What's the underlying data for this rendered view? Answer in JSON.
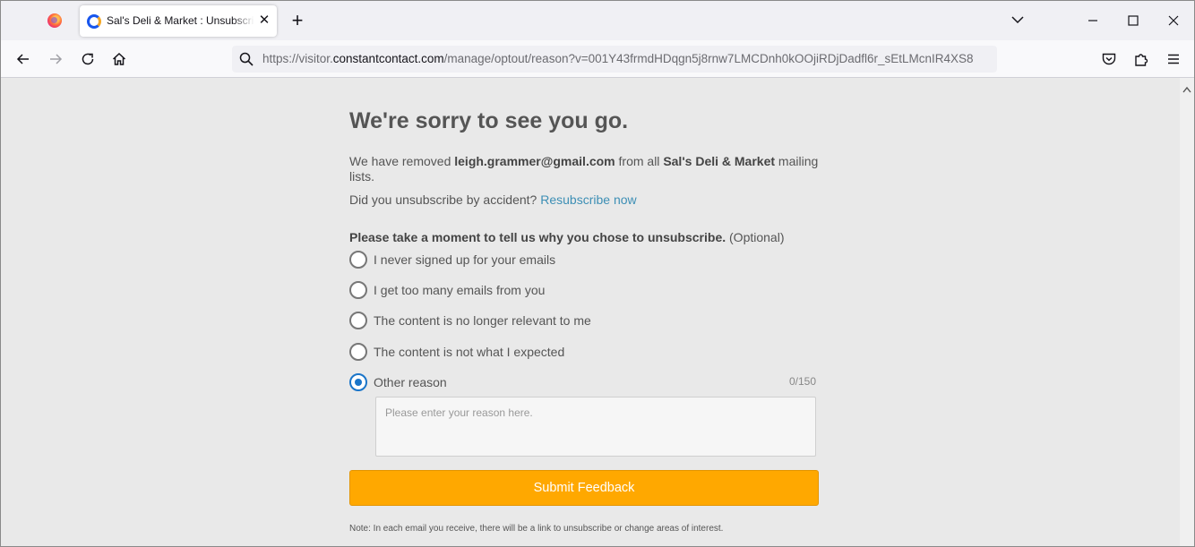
{
  "browser": {
    "tab_title": "Sal's Deli & Market : Unsubscribe",
    "tab_close": "✕",
    "new_tab": "+",
    "url_prefix": "https://visitor.",
    "url_host": "constantcontact.com",
    "url_path": "/manage/optout/reason?v=001Y43frmdHDqgn5j8rnw7LMCDnh0kOOjiRDjDadfl6r_sEtLMcnIR4XS8"
  },
  "page": {
    "heading": "We're sorry to see you go.",
    "removed_prefix": "We have removed ",
    "email": "leigh.grammer@gmail.com",
    "removed_middle": " from all ",
    "business_name": "Sal's Deli & Market",
    "removed_suffix": " mailing lists.",
    "accident_text": "Did you unsubscribe by accident? ",
    "resubscribe_link": "Resubscribe now",
    "question": "Please take a moment to tell us why you chose to unsubscribe.",
    "optional": " (Optional)",
    "options": [
      {
        "label": "I never signed up for your emails",
        "selected": false
      },
      {
        "label": "I get too many emails from you",
        "selected": false
      },
      {
        "label": "The content is no longer relevant to me",
        "selected": false
      },
      {
        "label": "The content is not what I expected",
        "selected": false
      },
      {
        "label": "Other reason",
        "selected": true
      }
    ],
    "char_count": "0/150",
    "reason_placeholder": "Please enter your reason here.",
    "submit_label": "Submit Feedback",
    "note": "Note: In each email you receive, there will be a link to unsubscribe or change areas of interest."
  },
  "colors": {
    "accent_orange": "#ffa800",
    "link_blue": "#3d8fb5",
    "radio_selected": "#1a75c9"
  }
}
